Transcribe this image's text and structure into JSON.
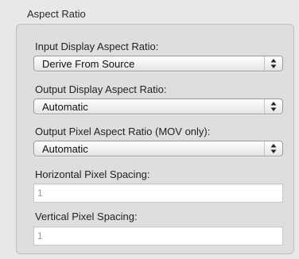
{
  "group": {
    "title": "Aspect Ratio"
  },
  "input_display": {
    "label": "Input Display Aspect Ratio:",
    "value": "Derive From Source"
  },
  "output_display": {
    "label": "Output Display Aspect Ratio:",
    "value": "Automatic"
  },
  "output_pixel": {
    "label": "Output Pixel Aspect Ratio (MOV only):",
    "value": "Automatic"
  },
  "horizontal_spacing": {
    "label": "Horizontal Pixel Spacing:",
    "value": "1"
  },
  "vertical_spacing": {
    "label": "Vertical Pixel Spacing:",
    "value": "1"
  },
  "icons": {
    "popup_arrows": "up-down-arrows-icon"
  }
}
